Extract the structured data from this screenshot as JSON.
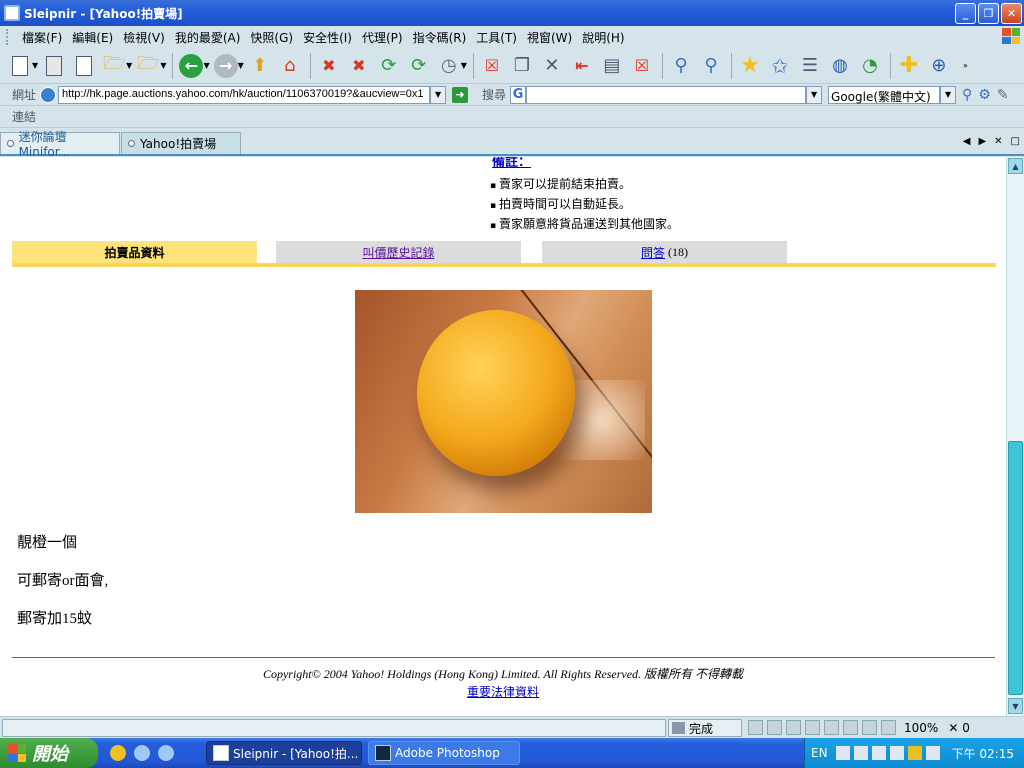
{
  "window": {
    "title": "Sleipnir - [Yahoo!拍賣場]"
  },
  "menu": [
    "檔案(F)",
    "編輯(E)",
    "檢視(V)",
    "我的最愛(A)",
    "快照(G)",
    "安全性(I)",
    "代理(P)",
    "指令碼(R)",
    "工具(T)",
    "視窗(W)",
    "說明(H)"
  ],
  "address": {
    "label": "網址",
    "url": "http://hk.page.auctions.yahoo.com/hk/auction/1106370019?&aucview=0x1",
    "search_label": "搜尋",
    "search_value": "",
    "engine": "Google(繁體中文)"
  },
  "links_label": "連結",
  "tabs": [
    {
      "label": "迷你論壇 Minifor..."
    },
    {
      "label": "Yahoo!拍賣場"
    }
  ],
  "page": {
    "crumb": "備註：",
    "features": [
      "賣家可以提前結束拍賣。",
      "拍賣時間可以自動延長。",
      "賣家願意將貨品運送到其他國家。"
    ],
    "product_tabs": {
      "info": "拍賣品資料",
      "bids": "叫價歷史記錄",
      "qa": "問答",
      "qa_count": "(18)"
    },
    "description": [
      "靚橙一個",
      "可郵寄or面會,",
      "郵寄加15蚊"
    ],
    "copyright": "Copyright© 2004 Yahoo! Holdings (Hong Kong) Limited. All Rights Reserved. 版權所有 不得轉載",
    "legal_link": "重要法律資料"
  },
  "status": {
    "text": "完成",
    "zoom": "100%",
    "x_count": "0"
  },
  "taskbar": {
    "start": "開始",
    "tasks": [
      "Sleipnir - [Yahoo!拍...",
      "Adobe Photoshop"
    ],
    "lang": "EN",
    "clock": "下午 02:15"
  }
}
